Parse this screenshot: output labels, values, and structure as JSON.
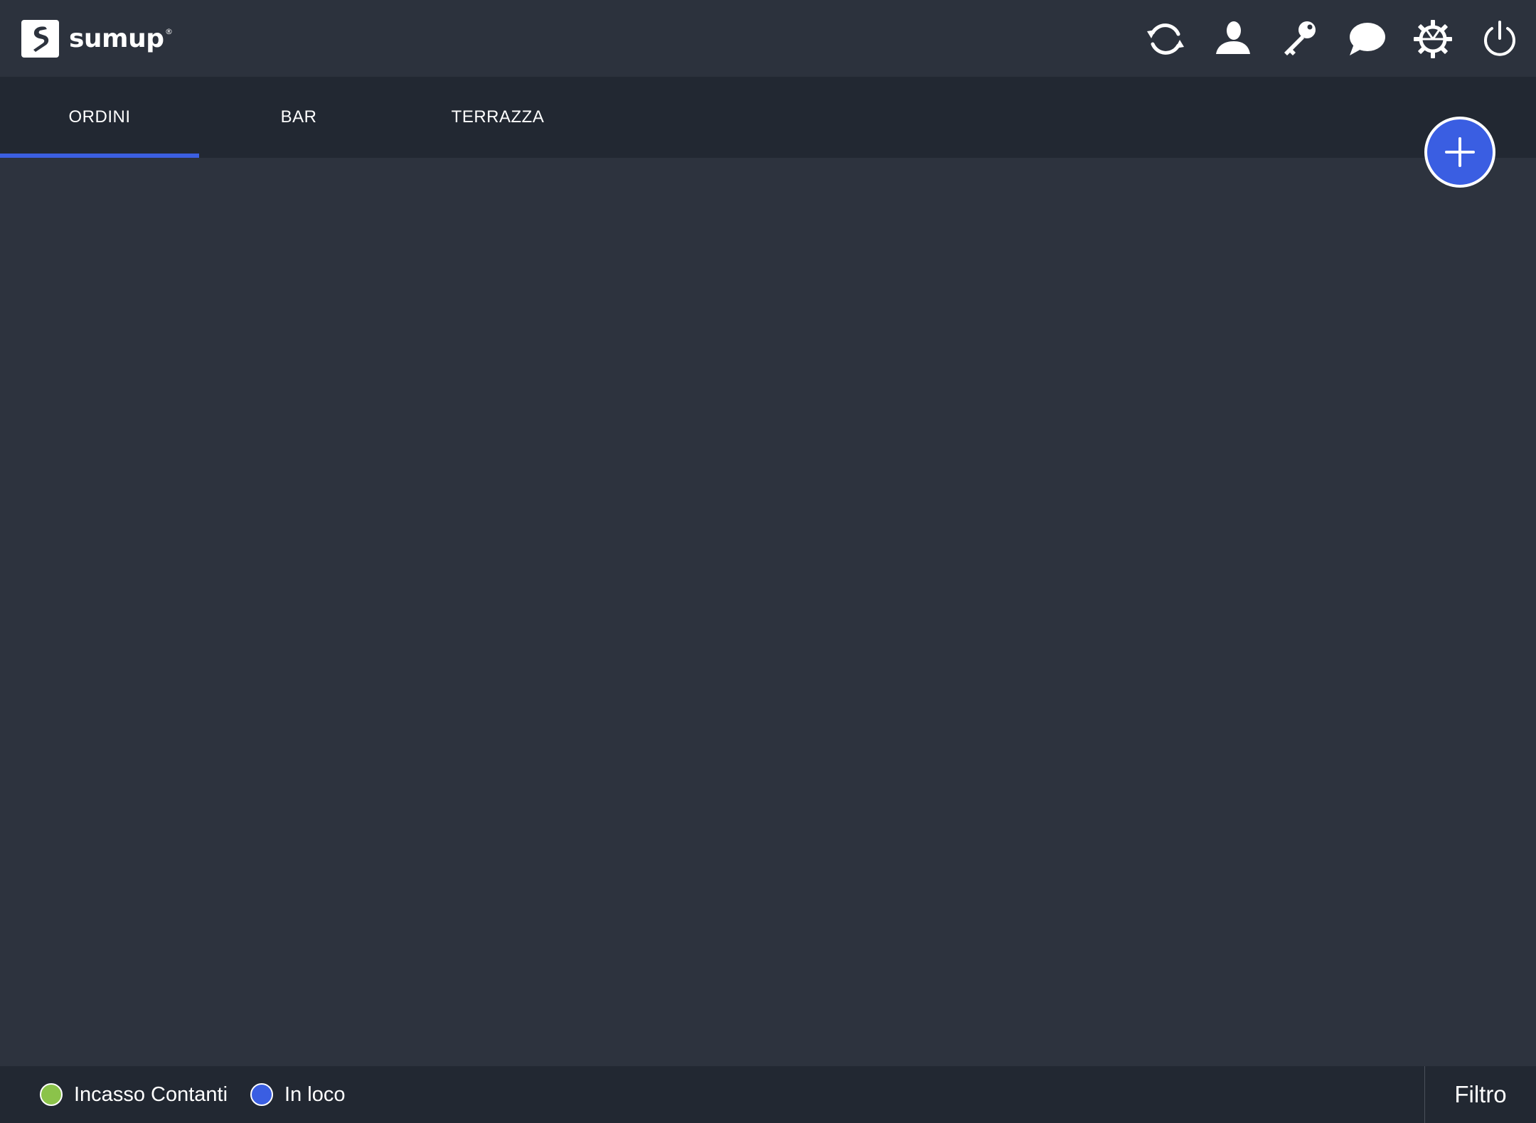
{
  "header": {
    "logo_text": "sumup",
    "logo_registered": "®",
    "icons": [
      {
        "name": "sync-icon"
      },
      {
        "name": "user-icon"
      },
      {
        "name": "key-icon"
      },
      {
        "name": "chat-icon"
      },
      {
        "name": "gear-icon"
      },
      {
        "name": "power-icon"
      }
    ]
  },
  "tabs": [
    {
      "label": "ORDINI",
      "active": true
    },
    {
      "label": "BAR",
      "active": false
    },
    {
      "label": "TERRAZZA",
      "active": false
    }
  ],
  "fab": {
    "icon": "plus-icon"
  },
  "footer": {
    "legend": [
      {
        "label": "Incasso Contanti",
        "color": "#8bc34a"
      },
      {
        "label": "In loco",
        "color": "#3a5ee2"
      }
    ],
    "filter_label": "Filtro"
  },
  "colors": {
    "accent": "#3a5ee2",
    "background": "#2d333e",
    "bar_background": "#222832"
  }
}
